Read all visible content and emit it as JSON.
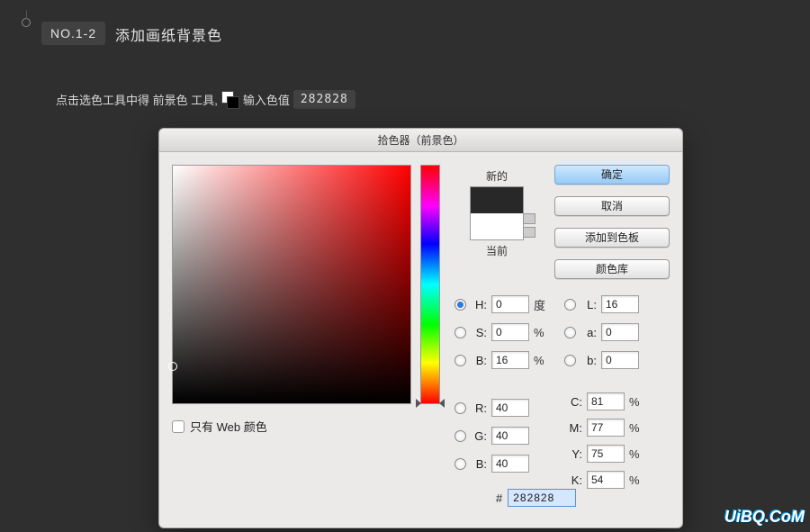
{
  "step": {
    "tag": "NO.1-2",
    "title": "添加画纸背景色"
  },
  "instruction": {
    "pre": "点击选色工具中得 前景色 工具,",
    "post": "输入色值",
    "value": "282828"
  },
  "picker": {
    "title": "拾色器（前景色）",
    "new_label": "新的",
    "current_label": "当前",
    "buttons": {
      "ok": "确定",
      "cancel": "取消",
      "add_swatch": "添加到色板",
      "libraries": "颜色库"
    },
    "web_only": "只有 Web 颜色",
    "hsb": {
      "h": "0",
      "h_unit": "度",
      "s": "0",
      "s_unit": "%",
      "b": "16",
      "b_unit": "%"
    },
    "lab": {
      "l": "16",
      "a": "0",
      "b": "0"
    },
    "rgb": {
      "r": "40",
      "g": "40",
      "b": "40"
    },
    "cmyk": {
      "c": "81",
      "m": "77",
      "y": "75",
      "k": "54"
    },
    "hex": "282828",
    "labels": {
      "H": "H:",
      "S": "S:",
      "B": "B:",
      "L": "L:",
      "a": "a:",
      "b": "b:",
      "R": "R:",
      "G": "G:",
      "Bb": "B:",
      "C": "C:",
      "M": "M:",
      "Y": "Y:",
      "K": "K:",
      "pct": "%",
      "hash": "#"
    }
  },
  "watermark": "UiBQ.CoM"
}
